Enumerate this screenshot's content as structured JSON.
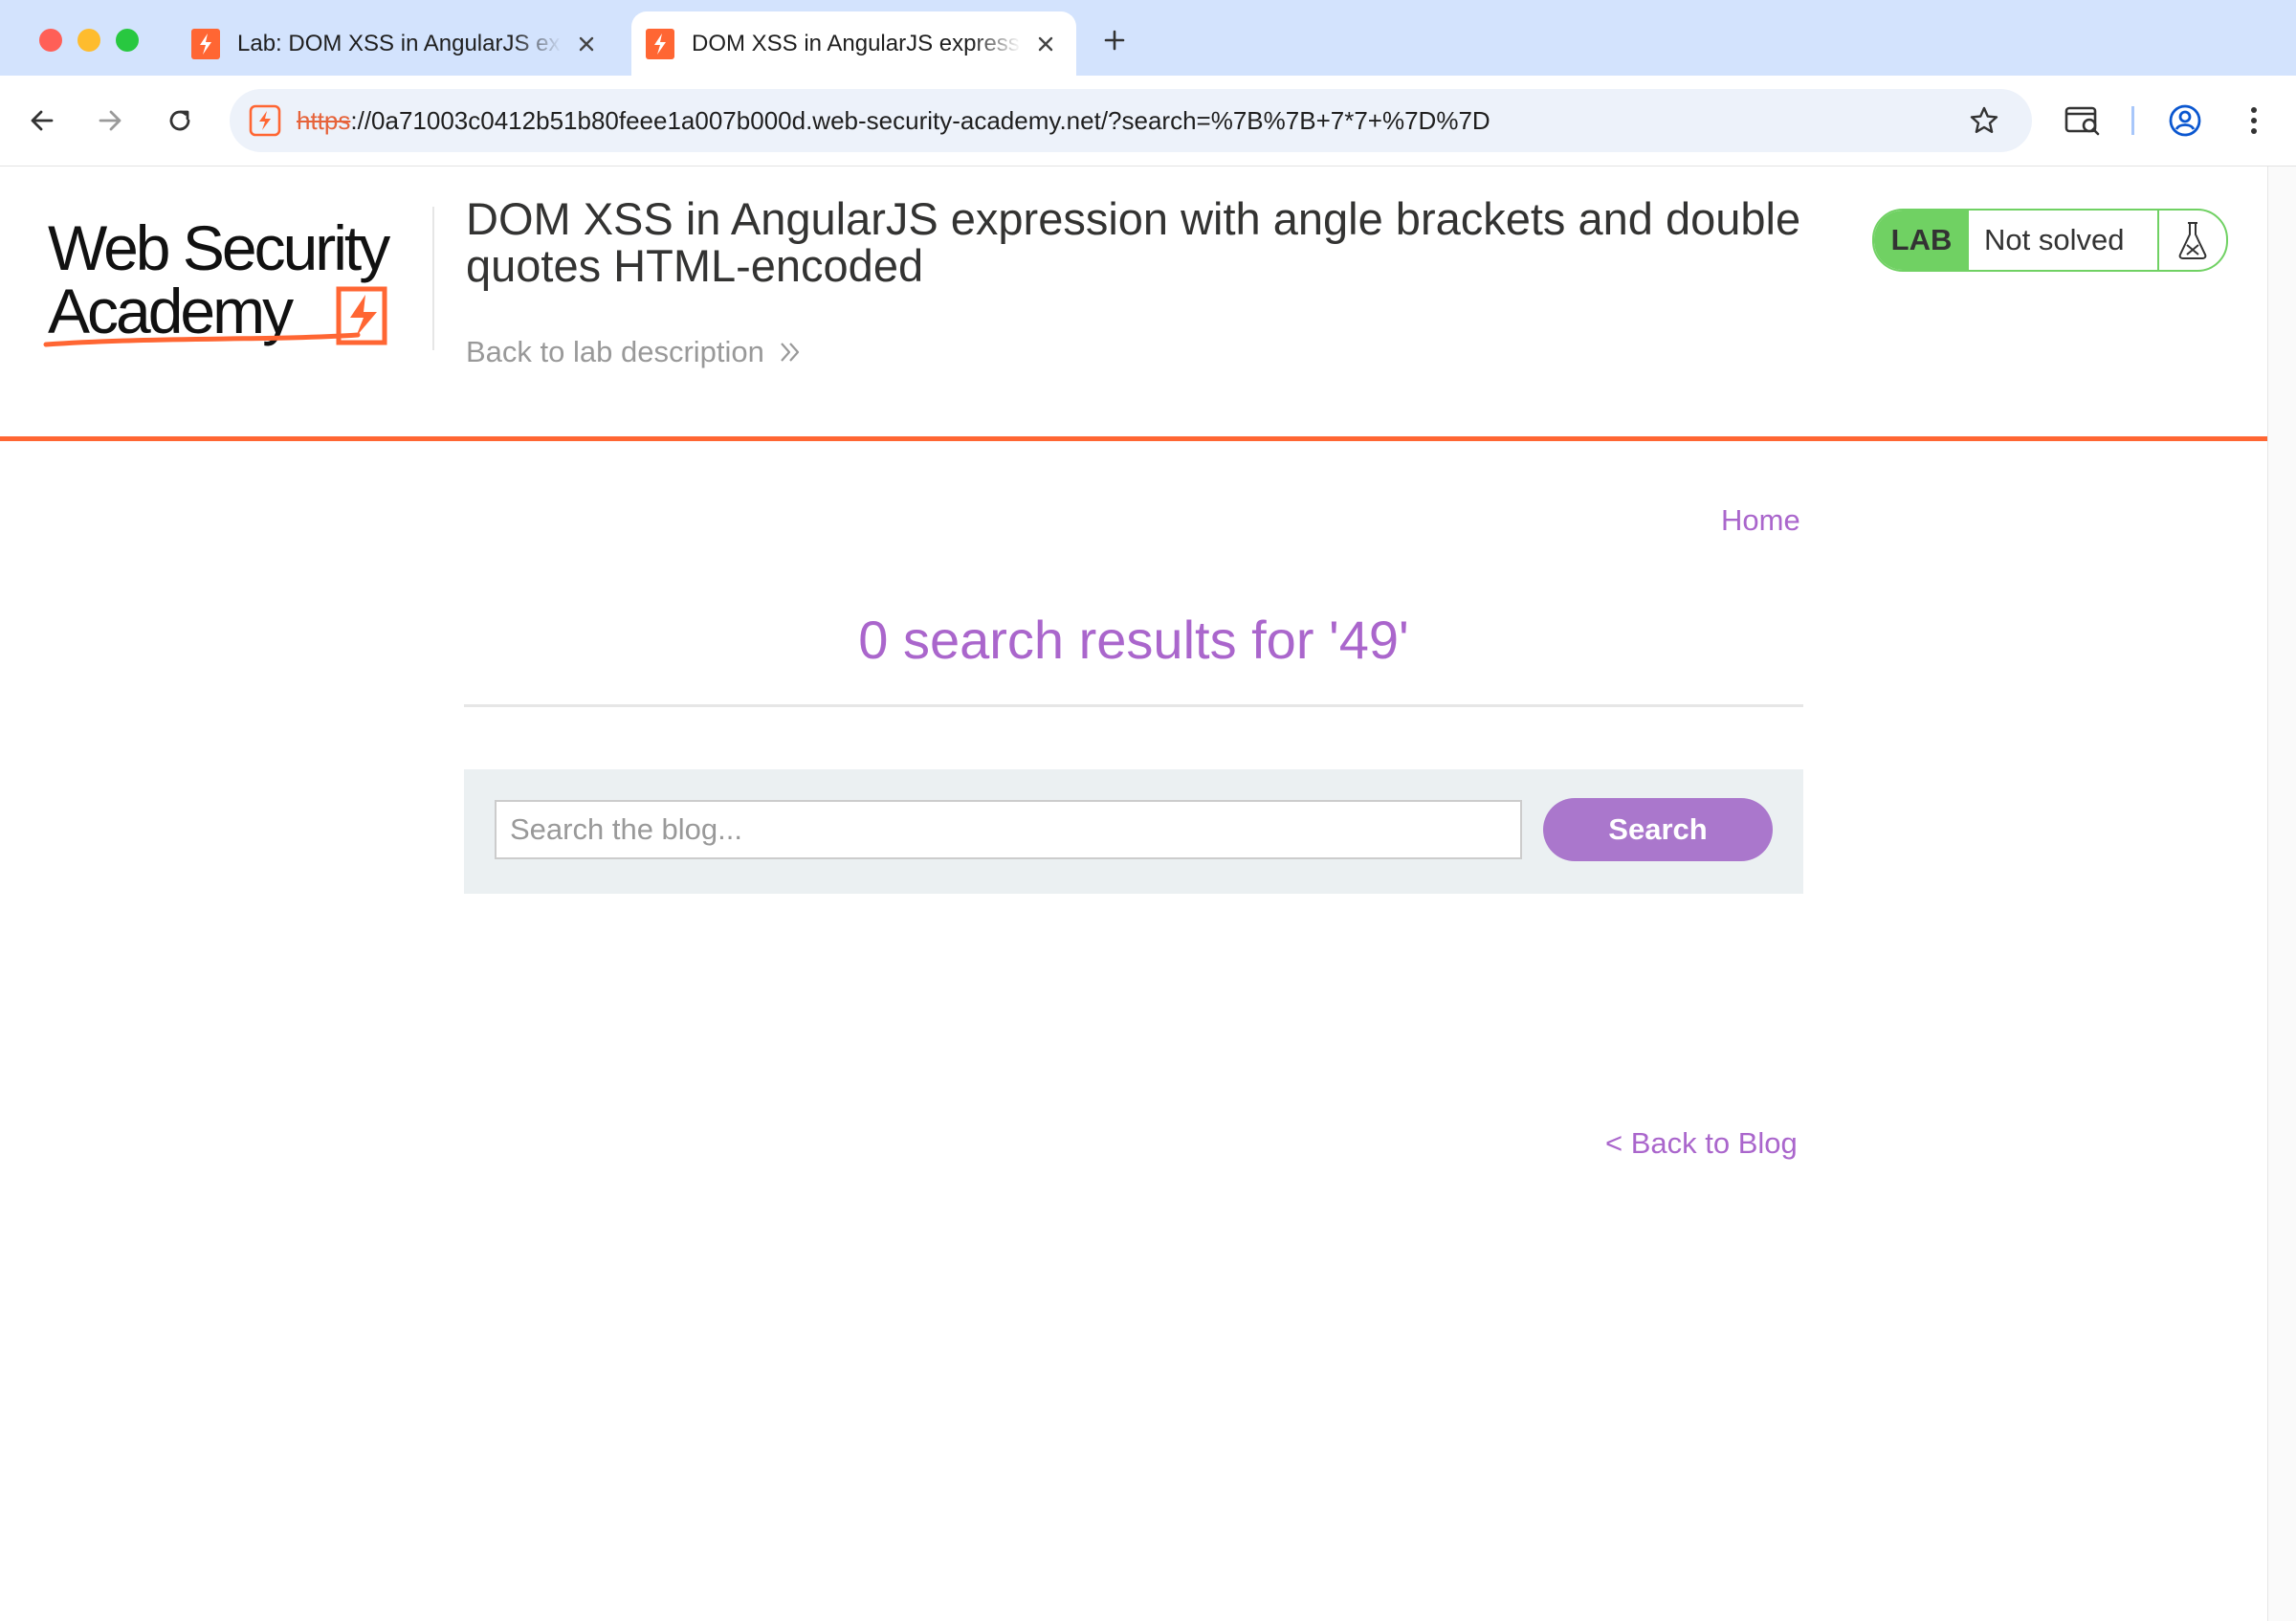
{
  "browser": {
    "tabs": [
      {
        "title": "Lab: DOM XSS in AngularJS expression with angle brackets and double quotes HTML-encoded",
        "active": false
      },
      {
        "title": "DOM XSS in AngularJS expression with angle brackets and double quotes HTML-encoded",
        "active": true
      }
    ],
    "url": {
      "scheme": "https",
      "rest": "://0a71003c0412b51b80feee1a007b000d.web-security-academy.net/?search=%7B%7B+7*7+%7D%7D"
    },
    "icons": [
      "back-arrow-icon",
      "forward-arrow-icon",
      "reload-icon",
      "star-icon",
      "tab-search-icon",
      "profile-icon",
      "kebab-menu-icon"
    ]
  },
  "header": {
    "logo_text": "Web Security Academy",
    "lab_title": "DOM XSS in AngularJS expression with angle brackets and double quotes HTML-encoded",
    "back_to_description": "Back to lab description",
    "badge": {
      "lab": "LAB",
      "status": "Not solved"
    }
  },
  "nav": {
    "home": "Home"
  },
  "main": {
    "results_heading": "0 search results for '49'",
    "search": {
      "placeholder": "Search the blog...",
      "value": "",
      "button": "Search"
    },
    "back_to_blog": "< Back to Blog"
  },
  "colors": {
    "accent_orange": "#ff6633",
    "link_purple": "#aa66cc",
    "button_purple": "#aa77cc",
    "lab_green": "#70d163",
    "tab_strip": "#d3e3fd"
  }
}
